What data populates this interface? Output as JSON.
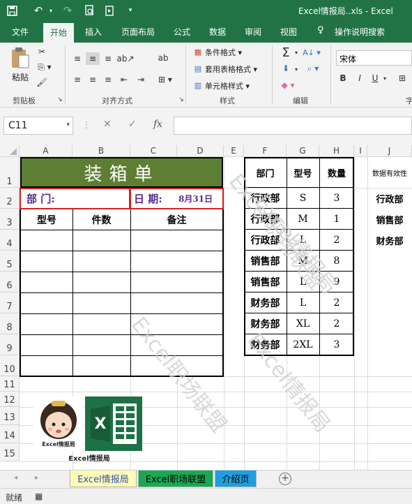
{
  "window": {
    "title": "Excel情报局..xls  -  Excel"
  },
  "ribbon_tabs": [
    "文件",
    "开始",
    "插入",
    "页面布局",
    "公式",
    "数据",
    "审阅",
    "视图",
    "操作说明搜索"
  ],
  "ribbon": {
    "paste_label": "粘贴",
    "groups": [
      "剪贴板",
      "对齐方式",
      "样式",
      "编辑",
      "字"
    ],
    "styles": [
      "条件格式",
      "套用表格格式",
      "单元格样式"
    ],
    "font_name": "宋体",
    "bold": "B",
    "italic": "I",
    "underline": "U",
    "wrap_label": "ab"
  },
  "formula_bar": {
    "cell_ref": "C11",
    "fx": "fx",
    "value": ""
  },
  "columns": [
    "A",
    "B",
    "C",
    "D",
    "E",
    "F",
    "G",
    "H",
    "I",
    "J"
  ],
  "rows": [
    "1",
    "2",
    "3",
    "4",
    "5",
    "6",
    "7",
    "8",
    "9",
    "10",
    "11",
    "12",
    "13",
    "14",
    "15"
  ],
  "packing": {
    "title": "装箱单",
    "dept_label": "部  门:",
    "date_label": "日  期:",
    "date_value": "8月31日",
    "headers": [
      "型号",
      "件数",
      "备注"
    ]
  },
  "data_table": {
    "headers": [
      "部门",
      "型号",
      "数量"
    ],
    "rows": [
      [
        "行政部",
        "S",
        "3"
      ],
      [
        "行政部",
        "M",
        "1"
      ],
      [
        "行政部",
        "L",
        "2"
      ],
      [
        "销售部",
        "M",
        "8"
      ],
      [
        "销售部",
        "L",
        "9"
      ],
      [
        "财务部",
        "L",
        "2"
      ],
      [
        "财务部",
        "XL",
        "2"
      ],
      [
        "财务部",
        "2XL",
        "3"
      ]
    ]
  },
  "validation": {
    "header": "数据有效性",
    "items": [
      "行政部",
      "销售部",
      "财务部"
    ]
  },
  "logo": {
    "mascot_caption": "Excel情报局",
    "brand_caption": "Excel情报局"
  },
  "watermarks": [
    "Excel职场联盟",
    "Excel情报局",
    "Excel职场联盟",
    "Excel情报局"
  ],
  "sheets": [
    "Excel情报局",
    "Excel职场联盟",
    "介绍页"
  ],
  "status": {
    "ready": "就绪"
  },
  "colors": {
    "excel_green": "#217346",
    "title_green": "#5d7f34",
    "accent_red": "#d62020",
    "purple": "#5b2a8c"
  }
}
